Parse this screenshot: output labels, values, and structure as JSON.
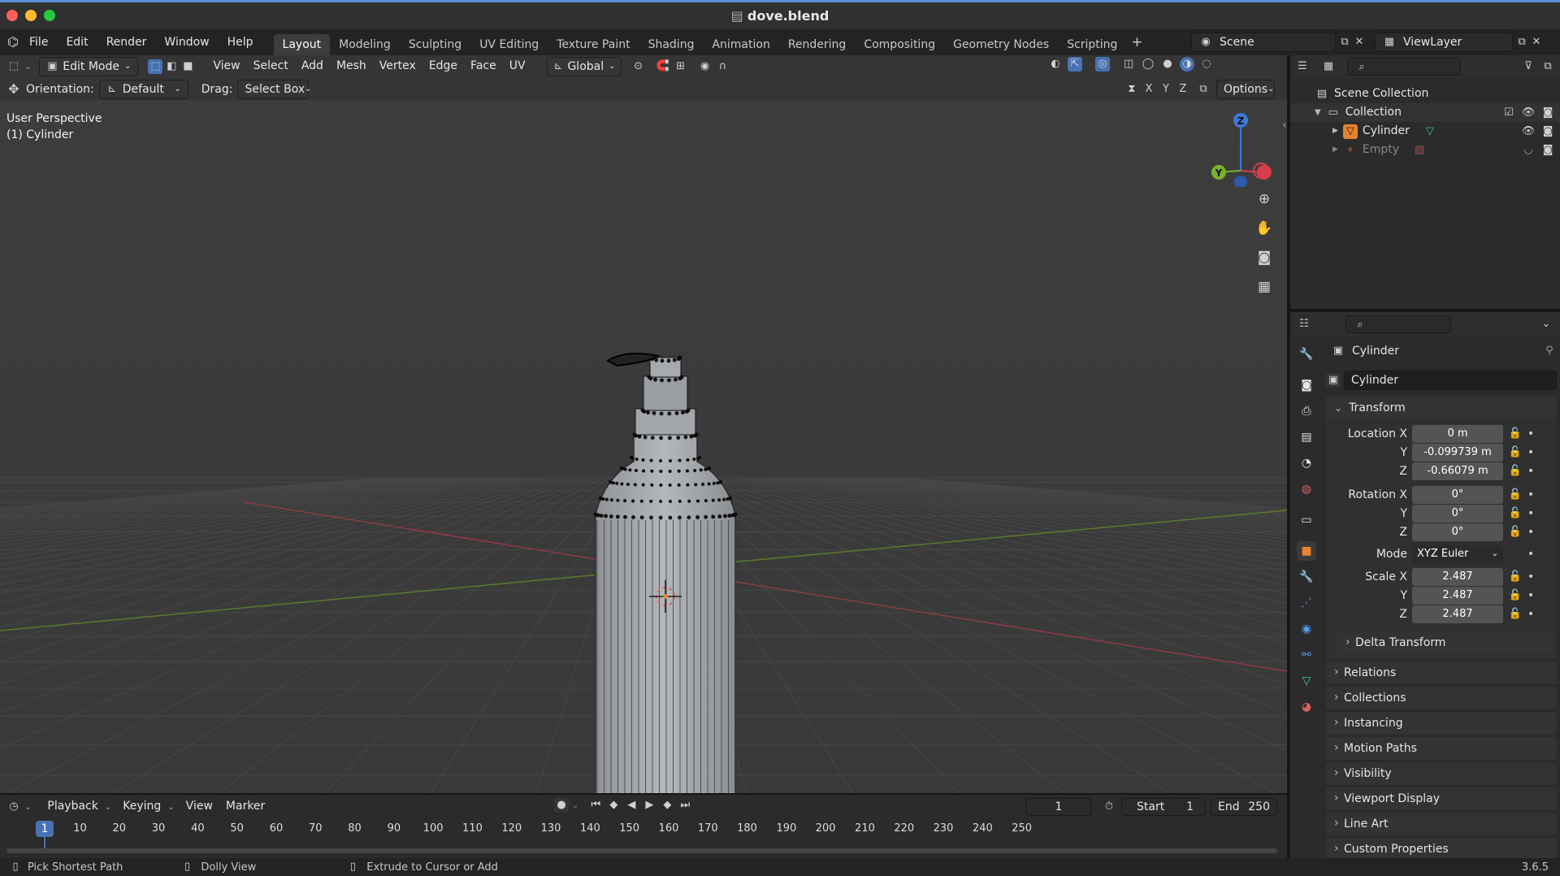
{
  "window": {
    "title": "dove.blend",
    "version": "3.6.5"
  },
  "menu": [
    "File",
    "Edit",
    "Render",
    "Window",
    "Help"
  ],
  "workspaces": [
    {
      "label": "Layout",
      "active": true
    },
    {
      "label": "Modeling"
    },
    {
      "label": "Sculpting"
    },
    {
      "label": "UV Editing"
    },
    {
      "label": "Texture Paint"
    },
    {
      "label": "Shading"
    },
    {
      "label": "Animation"
    },
    {
      "label": "Rendering"
    },
    {
      "label": "Compositing"
    },
    {
      "label": "Geometry Nodes"
    },
    {
      "label": "Scripting"
    }
  ],
  "scene": {
    "name": "Scene",
    "view_layer": "ViewLayer"
  },
  "viewport_header": {
    "mode": "Edit Mode",
    "menus": [
      "View",
      "Select",
      "Add",
      "Mesh",
      "Vertex",
      "Edge",
      "Face",
      "UV"
    ],
    "transform_space": "Global",
    "orientation_label": "Orientation:",
    "orientation_value": "Default",
    "drag_label": "Drag:",
    "drag_value": "Select Box",
    "axes": [
      "X",
      "Y",
      "Z"
    ],
    "options": "Options"
  },
  "viewport": {
    "perspective": "User Perspective",
    "object": "(1) Cylinder"
  },
  "gizmo": {
    "z": "Z",
    "y": "Y"
  },
  "outliner": {
    "root": "Scene Collection",
    "collection": "Collection",
    "items": [
      {
        "label": "Cylinder"
      },
      {
        "label": "Empty"
      }
    ]
  },
  "properties": {
    "object_name": "Cylinder",
    "datablock": "Cylinder",
    "transform_title": "Transform",
    "location": {
      "label": "Location X",
      "x": "0 m",
      "y": "-0.099739 m",
      "z": "-0.66079 m"
    },
    "rotation": {
      "label": "Rotation X",
      "x": "0°",
      "y": "0°",
      "z": "0°"
    },
    "mode_label": "Mode",
    "mode_value": "XYZ Euler",
    "scale": {
      "label": "Scale X",
      "x": "2.487",
      "y": "2.487",
      "z": "2.487"
    },
    "axis_y": "Y",
    "axis_z": "Z",
    "delta": "Delta Transform",
    "sections": [
      "Relations",
      "Collections",
      "Instancing",
      "Motion Paths",
      "Visibility",
      "Viewport Display",
      "Line Art",
      "Custom Properties"
    ]
  },
  "timeline": {
    "menus": [
      "Playback",
      "Keying",
      "View",
      "Marker"
    ],
    "current_frame": "1",
    "start_label": "Start",
    "start": "1",
    "end_label": "End",
    "end": "250",
    "ticks": [
      "10",
      "20",
      "30",
      "40",
      "50",
      "60",
      "70",
      "80",
      "90",
      "100",
      "110",
      "120",
      "130",
      "140",
      "150",
      "160",
      "170",
      "180",
      "190",
      "200",
      "210",
      "220",
      "230",
      "240",
      "250"
    ]
  },
  "statusbar": {
    "hint1": "Pick Shortest Path",
    "hint2": "Dolly View",
    "hint3": "Extrude to Cursor or Add"
  },
  "colors": {
    "accent": "#4772b3",
    "x_axis": "#d83c4a",
    "y_axis": "#77b32a",
    "z_axis": "#3d7ad8",
    "active_object": "#e8842e"
  }
}
